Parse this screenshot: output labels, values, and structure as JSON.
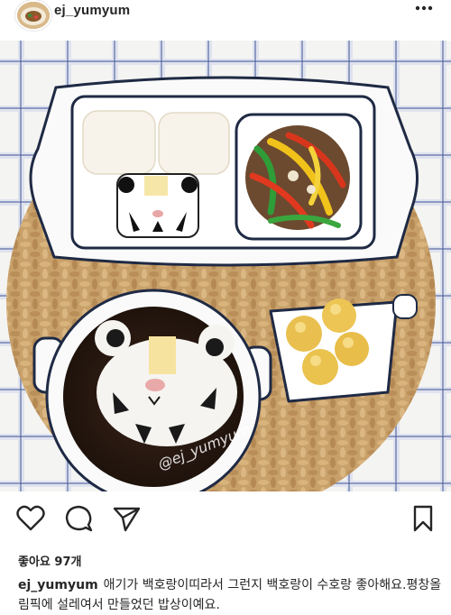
{
  "post": {
    "username": "ej_yumyum",
    "watermark": "@ej_yumyum",
    "likes_text": "좋아요 97개",
    "caption_user": "ej_yumyum",
    "caption_text": "애기가 백호랑이띠라서 그런지 백호랑이 수호랑 좋아해요.평창올림픽에 설레여서 만들었던 밥상이예요."
  },
  "icons": {
    "more": "more-horizontal-icon",
    "like": "heart-icon",
    "comment": "comment-icon",
    "share": "send-icon",
    "save": "bookmark-icon"
  },
  "colors": {
    "text": "#262626",
    "tablecloth_line": "#4a5f9e",
    "mat": "#c8a06a",
    "plate_rim": "#1f2a44"
  }
}
